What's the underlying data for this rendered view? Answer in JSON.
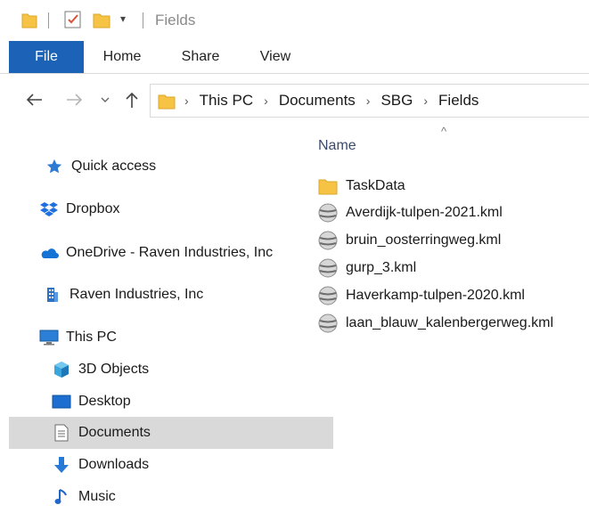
{
  "window": {
    "title": "Fields"
  },
  "ribbon": {
    "tabs": [
      "File",
      "Home",
      "Share",
      "View"
    ]
  },
  "address": {
    "crumbs": [
      "This PC",
      "Documents",
      "SBG",
      "Fields"
    ]
  },
  "nav": {
    "items": [
      {
        "label": "Quick access",
        "icon": "quick-access-star-icon"
      },
      {
        "label": "Dropbox",
        "icon": "dropbox-icon"
      },
      {
        "label": "OneDrive - Raven Industries, Inc",
        "icon": "onedrive-cloud-icon"
      },
      {
        "label": "Raven Industries, Inc",
        "icon": "building-icon"
      },
      {
        "label": "This PC",
        "icon": "computer-icon"
      },
      {
        "label": "3D Objects",
        "icon": "3d-objects-icon"
      },
      {
        "label": "Desktop",
        "icon": "desktop-icon"
      },
      {
        "label": "Documents",
        "icon": "documents-icon",
        "selected": true
      },
      {
        "label": "Downloads",
        "icon": "downloads-icon"
      },
      {
        "label": "Music",
        "icon": "music-icon"
      }
    ]
  },
  "content": {
    "column_header": "Name",
    "files": [
      {
        "name": "TaskData",
        "icon": "folder-icon"
      },
      {
        "name": "Averdijk-tulpen-2021.kml",
        "icon": "kml-file-icon"
      },
      {
        "name": "bruin_oosterringweg.kml",
        "icon": "kml-file-icon"
      },
      {
        "name": "gurp_3.kml",
        "icon": "kml-file-icon"
      },
      {
        "name": "Haverkamp-tulpen-2020.kml",
        "icon": "kml-file-icon"
      },
      {
        "name": "laan_blauw_kalenbergerweg.kml",
        "icon": "kml-file-icon"
      }
    ]
  },
  "colors": {
    "file_tab": "#1c63b8",
    "folder": "#f6c344",
    "selection": "#d9d9d9",
    "column_header": "#3b4a6b"
  }
}
